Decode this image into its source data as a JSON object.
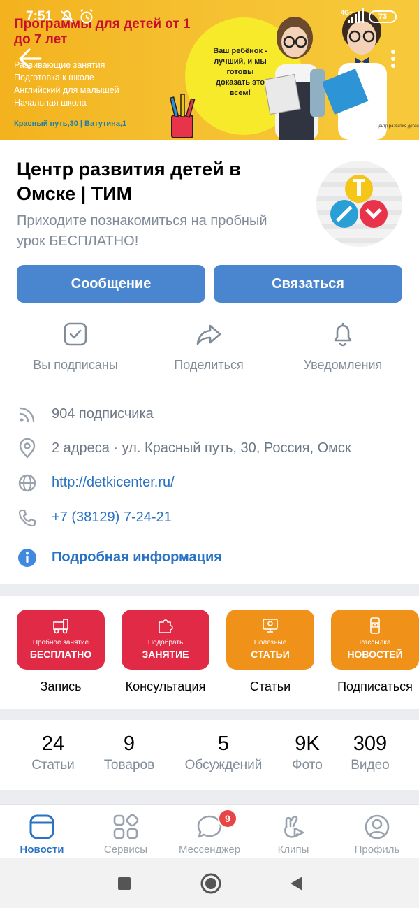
{
  "status_bar": {
    "time": "7:51",
    "network": "4G+",
    "battery": "73"
  },
  "cover": {
    "title": "Программы для детей от 1 до 7 лет",
    "programs": [
      "Развивающие занятия",
      "Подготовка к школе",
      "Английский для малышей",
      "Начальная школа"
    ],
    "addresses": "Красный путь,30 | Ватутина,1",
    "slogan": "Ваш ребёнок - лучший, и мы готовы доказать это всем!",
    "brand": "Центр развития детей"
  },
  "group": {
    "title": "Центр развития детей в Омске | ТИМ",
    "status": "Приходите познакомиться на пробный урок БЕСПЛАТНО!"
  },
  "buttons": {
    "message": "Сообщение",
    "contact": "Связаться"
  },
  "actions": {
    "subscribed": "Вы подписаны",
    "share": "Поделиться",
    "notifications": "Уведомления"
  },
  "info": {
    "subscribers": "904 подписчика",
    "address": "2 адреса · ул. Красный путь, 30, Россия, Омск",
    "website": "http://detkicenter.ru/",
    "phone": "+7 (38129) 7-24-21",
    "details": "Подробная информация"
  },
  "menu": [
    {
      "small": "Пробное занятие",
      "big": "БЕСПЛАТНО",
      "caption": "Запись",
      "color": "#e02a46",
      "icon": "train-icon"
    },
    {
      "small": "Подобрать",
      "big": "ЗАНЯТИЕ",
      "caption": "Консультация",
      "color": "#e02a46",
      "icon": "puzzle-icon"
    },
    {
      "small": "Полезные",
      "big": "СТАТЬИ",
      "caption": "Статьи",
      "color": "#f0921a",
      "icon": "monitor-icon"
    },
    {
      "small": "Рассылка",
      "big": "НОВОСТЕЙ",
      "caption": "Подписаться",
      "color": "#f0921a",
      "icon": "phone-mail-icon"
    }
  ],
  "counters": [
    {
      "value": "24",
      "label": "Статьи"
    },
    {
      "value": "9",
      "label": "Товаров"
    },
    {
      "value": "5",
      "label": "Обсуждений"
    },
    {
      "value": "9K",
      "label": "Фото"
    },
    {
      "value": "309",
      "label": "Видео"
    }
  ],
  "tabs": {
    "news": "Новости",
    "services": "Сервисы",
    "messenger": "Мессенджер",
    "messenger_badge": "9",
    "clips": "Клипы",
    "profile": "Профиль"
  },
  "colors": {
    "accent": "#4a86d0",
    "link": "#2a73c4",
    "secondary_text": "#818c99",
    "badge": "#e64646"
  }
}
